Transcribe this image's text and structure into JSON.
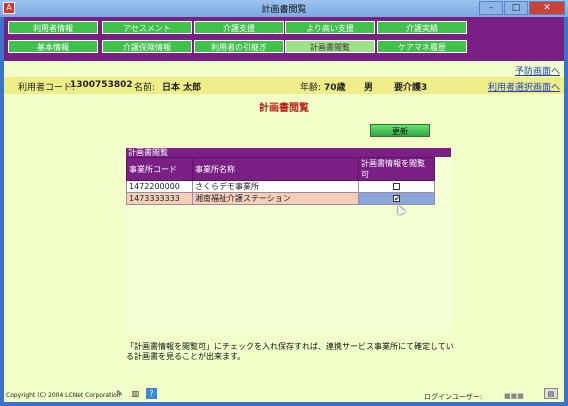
{
  "window": {
    "title": "計画書閲覧",
    "minimize": "–",
    "maximize": "□",
    "close": "✕"
  },
  "nav": {
    "row1": [
      "利用者情報",
      "アセスメント",
      "介護支援",
      "より高い支援",
      "介護実績"
    ],
    "row2": [
      "基本情報",
      "介護保険情報",
      "利用者の引継ぎ",
      "計画書閲覧",
      "ケアマネ履歴"
    ],
    "active": "計画書閲覧"
  },
  "links": {
    "prevention": "予防画面へ",
    "user_select": "利用者選択画面へ"
  },
  "user": {
    "code_label": "利用者コード:",
    "code": "1300753802",
    "name_label": "名前:",
    "name": "日本 太郎",
    "age_label": "年齢:",
    "age": "70歳",
    "sex": "男",
    "care_level": "要介護3"
  },
  "page": {
    "title": "計画書閲覧",
    "update_button": "更新"
  },
  "panel": {
    "header": "計画書閲覧",
    "columns": [
      "事業所コード",
      "事業所名称",
      "計画書情報を閲覧可"
    ],
    "rows": [
      {
        "code": "1472200000",
        "name": "さくらデモ事業所",
        "checked": false,
        "selected": false
      },
      {
        "code": "1473333333",
        "name": "湘南福祉介護ステーション",
        "checked": true,
        "selected": true
      }
    ]
  },
  "note": "「計画書情報を閲覧可」にチェックを入れ保存すれば、連携サービス事業所にて確定している計画書を見ることが出来ます。",
  "footer": {
    "copyright": "Copyright (C) 2004 LCNet Corporation",
    "login_label": "ログインユーザー:",
    "login_user": "■■■"
  },
  "colors": {
    "nav_bg": "#7a1f84",
    "tab": "#3fc24a",
    "page_bg": "#f2ffc8",
    "title_red": "#c0201a",
    "link": "#1d3fc8"
  }
}
